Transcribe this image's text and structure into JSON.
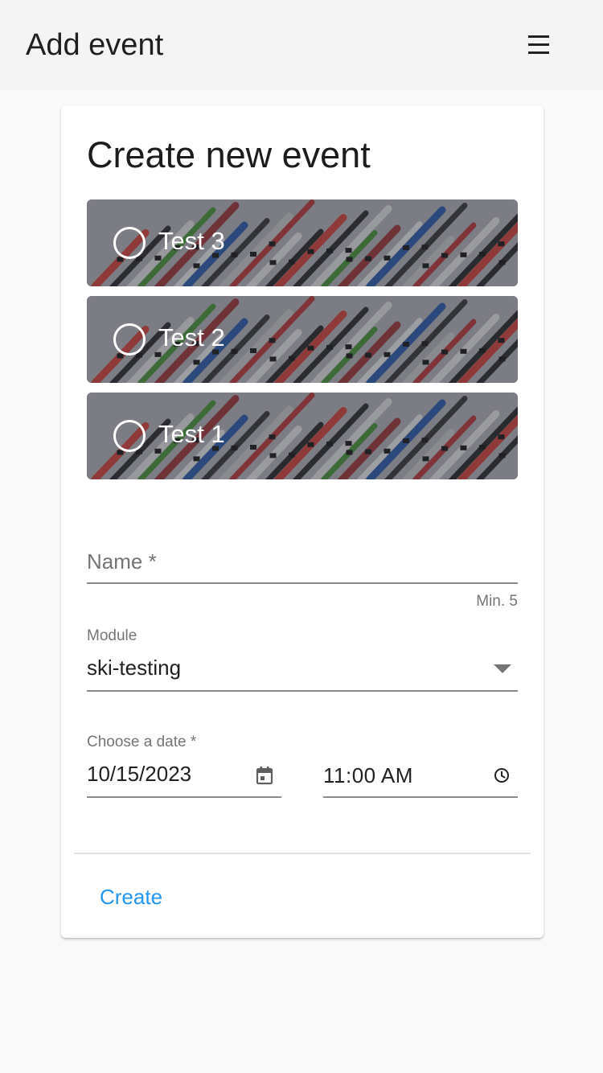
{
  "app_bar": {
    "title": "Add event",
    "menu_icon": "hamburger-menu-icon"
  },
  "card": {
    "title": "Create new event",
    "events": [
      {
        "label": "Test 3",
        "selected": false,
        "image": "skis-on-snow"
      },
      {
        "label": "Test 2",
        "selected": false,
        "image": "skis-on-snow"
      },
      {
        "label": "Test 1",
        "selected": false,
        "image": "skis-on-snow"
      }
    ],
    "name_field": {
      "placeholder": "Name *",
      "value": "",
      "hint": "Min. 5"
    },
    "module": {
      "label": "Module",
      "value": "ski-testing",
      "icon": "dropdown-arrow-icon"
    },
    "date": {
      "label": "Choose a date *",
      "date_value": "10/15/2023",
      "time_value": "11:00  AM",
      "date_icon": "calendar-icon",
      "time_icon": "clock-icon"
    },
    "create_label": "Create"
  },
  "colors": {
    "primary": "#2196f3",
    "app_bar_bg": "#f4f4f4",
    "page_bg": "#f9f9f9"
  }
}
